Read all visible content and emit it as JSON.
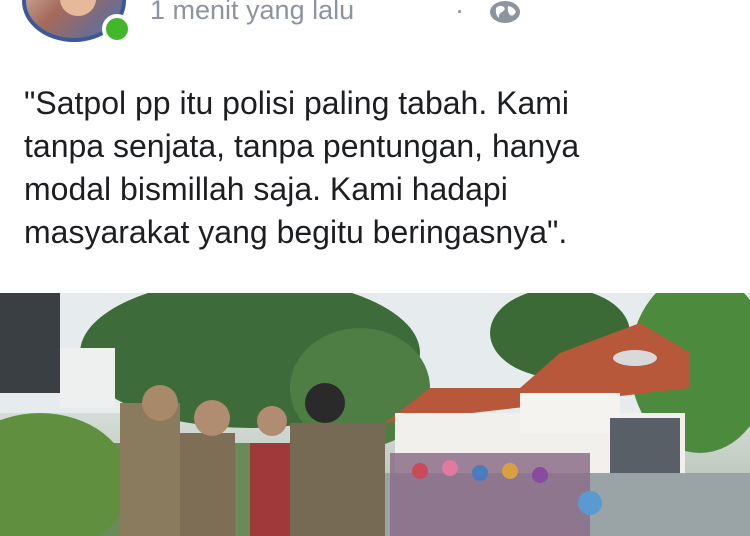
{
  "post": {
    "timestamp": "1 menit yang lalu",
    "separator": "·",
    "privacy_icon": "globe-icon",
    "text_lines": [
      "\"Satpol pp itu polisi paling tabah. Kami",
      "tanpa senjata, tanpa pentungan, hanya",
      "modal bismillah saja. Kami hadapi",
      "masyarakat yang begitu beringasnya\"."
    ]
  },
  "colors": {
    "online": "#42b72a",
    "meta": "#8d949e",
    "text": "#1c1e21",
    "avatar_ring": "#3b5998"
  }
}
